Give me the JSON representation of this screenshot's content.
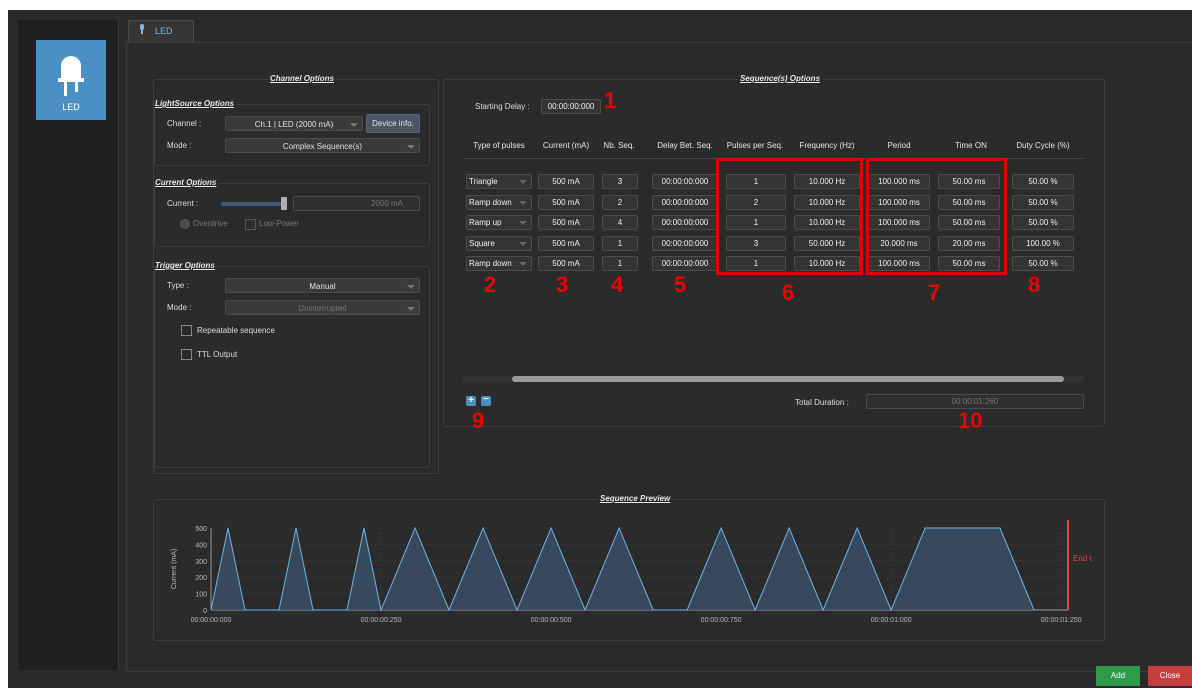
{
  "sidebar": {
    "device_label": "LED"
  },
  "tab": {
    "label": "LED"
  },
  "channel_options": {
    "title": "Channel Options",
    "lightsource": {
      "title": "LightSource Options",
      "channel_label": "Channel :",
      "channel_value": "Ch.1 | LED (2000 mA)",
      "device_info_button": "Device info.",
      "mode_label": "Mode :",
      "mode_value": "Complex Sequence(s)"
    },
    "current": {
      "title": "Current Options",
      "current_label": "Current :",
      "current_value": "2000 mA",
      "overdrive_label": "Overdrive",
      "lowpower_label": "Low-Power"
    },
    "trigger": {
      "title": "Trigger Options",
      "type_label": "Type :",
      "type_value": "Manual",
      "mode_label": "Mode :",
      "mode_value": "Uninterrupted",
      "repeatable_label": "Repeatable sequence",
      "ttl_label": "TTL Output"
    }
  },
  "sequence_options": {
    "title": "Sequence(s) Options",
    "starting_delay_label": "Starting Delay :",
    "starting_delay_value": "00:00:00:000",
    "columns": [
      "Type of pulses",
      "Current (mA)",
      "Nb. Seq.",
      "Delay Bet. Seq.",
      "Pulses per Seq.",
      "Frequency (Hz)",
      "Period",
      "Time ON",
      "Duty Cycle (%)"
    ],
    "rows": [
      {
        "type": "Triangle",
        "current": "500 mA",
        "nb_seq": "3",
        "delay": "00:00:00:000",
        "pulses": "1",
        "freq": "10.000 Hz",
        "period": "100.000 ms",
        "time_on": "50.00 ms",
        "duty": "50.00 %"
      },
      {
        "type": "Ramp down",
        "current": "500 mA",
        "nb_seq": "2",
        "delay": "00:00:00:000",
        "pulses": "2",
        "freq": "10.000 Hz",
        "period": "100.000 ms",
        "time_on": "50.00 ms",
        "duty": "50.00 %"
      },
      {
        "type": "Ramp up",
        "current": "500 mA",
        "nb_seq": "4",
        "delay": "00:00:00:000",
        "pulses": "1",
        "freq": "10.000 Hz",
        "period": "100.000 ms",
        "time_on": "50.00 ms",
        "duty": "50.00 %"
      },
      {
        "type": "Square",
        "current": "500 mA",
        "nb_seq": "1",
        "delay": "00:00:00:000",
        "pulses": "3",
        "freq": "50.000 Hz",
        "period": "20.000 ms",
        "time_on": "20.00 ms",
        "duty": "100.00 %"
      },
      {
        "type": "Ramp down",
        "current": "500 mA",
        "nb_seq": "1",
        "delay": "00:00:00:000",
        "pulses": "1",
        "freq": "10.000 Hz",
        "period": "100.000 ms",
        "time_on": "50.00 ms",
        "duty": "50.00 %"
      }
    ],
    "total_duration_label": "Total Duration :",
    "total_duration_value": "00:00:01:260"
  },
  "annotations": [
    "1",
    "2",
    "3",
    "4",
    "5",
    "6",
    "7",
    "8",
    "9",
    "10"
  ],
  "preview": {
    "title": "Sequence Preview",
    "ylabel": "Current (mA)",
    "y_ticks": [
      "500",
      "400",
      "300",
      "200",
      "100",
      "0"
    ],
    "x_ticks": [
      "00:00:00:000",
      "00:00:00:250",
      "00:00:00:500",
      "00:00:00:750",
      "00:00:01:000",
      "00:00:01:250"
    ],
    "end_label": "End of previe",
    "colors": {
      "fill": "#3b4f66",
      "line": "#6fb3e6",
      "end_marker": "#e04848"
    }
  },
  "chart_data": {
    "type": "area",
    "ylabel": "Current (mA)",
    "ylim": [
      0,
      500
    ],
    "xlim_ms": [
      0,
      1260
    ],
    "series": [
      {
        "points_ms_mA": [
          [
            0,
            0
          ],
          [
            25,
            500
          ],
          [
            50,
            0
          ],
          [
            100,
            0
          ],
          [
            125,
            500
          ],
          [
            150,
            0
          ],
          [
            200,
            0
          ],
          [
            225,
            500
          ],
          [
            250,
            0
          ],
          [
            300,
            500
          ],
          [
            350,
            0
          ],
          [
            400,
            500
          ],
          [
            450,
            0
          ],
          [
            500,
            500
          ],
          [
            550,
            0
          ],
          [
            600,
            500
          ],
          [
            650,
            0
          ],
          [
            700,
            0
          ],
          [
            750,
            500
          ],
          [
            800,
            0
          ],
          [
            850,
            500
          ],
          [
            900,
            0
          ],
          [
            950,
            500
          ],
          [
            1000,
            0
          ],
          [
            1050,
            500
          ],
          [
            1100,
            500
          ],
          [
            1160,
            500
          ],
          [
            1160,
            500
          ],
          [
            1210,
            0
          ]
        ]
      }
    ],
    "end_of_preview_ms": 1260
  },
  "footer": {
    "add_button": "Add",
    "close_button": "Close"
  }
}
